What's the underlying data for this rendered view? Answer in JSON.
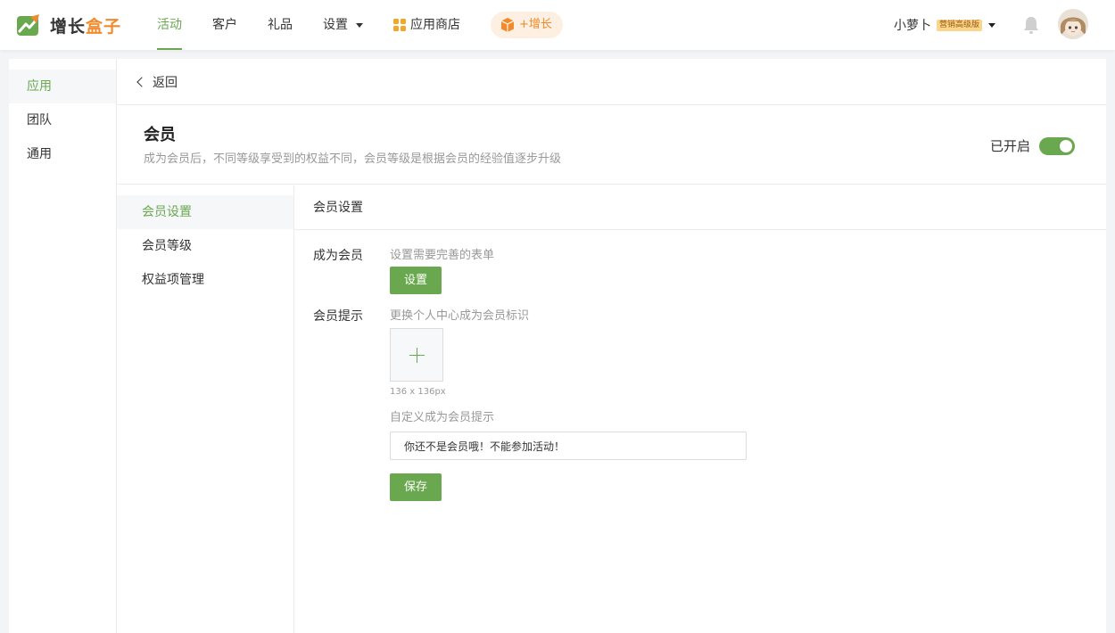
{
  "topbar": {
    "logo_part1": "增长",
    "logo_part2": "盒子",
    "nav": [
      {
        "label": "活动",
        "active": true
      },
      {
        "label": "客户"
      },
      {
        "label": "礼品"
      },
      {
        "label": "设置",
        "has_dropdown": true
      },
      {
        "label": "应用商店",
        "icon": "app-store-icon"
      }
    ],
    "growth_label": "+增长",
    "user_name": "小萝卜",
    "plan_badge": "营销高级版"
  },
  "sidebar": {
    "items": [
      {
        "label": "应用",
        "active": true
      },
      {
        "label": "团队"
      },
      {
        "label": "通用"
      }
    ]
  },
  "main": {
    "back_label": "返回",
    "title": "会员",
    "description": "成为会员后，不同等级享受到的权益不同，会员等级是根据会员的经验值逐步升级",
    "toggle_label": "已开启",
    "toggle_on": true
  },
  "subnav": {
    "items": [
      {
        "label": "会员设置",
        "active": true
      },
      {
        "label": "会员等级"
      },
      {
        "label": "权益项管理"
      }
    ]
  },
  "panel": {
    "title": "会员设置",
    "become_member": {
      "label": "成为会员",
      "hint": "设置需要完善的表单",
      "button": "设置"
    },
    "member_tip": {
      "label": "会员提示",
      "hint": "更换个人中心成为会员标识",
      "size_note": "136 x 136px",
      "custom_hint": "自定义成为会员提示",
      "input_value": "你还不是会员哦！不能参加活动！"
    },
    "save_button": "保存"
  },
  "colors": {
    "accent": "#6aa84f",
    "orange": "#f08a2c"
  }
}
